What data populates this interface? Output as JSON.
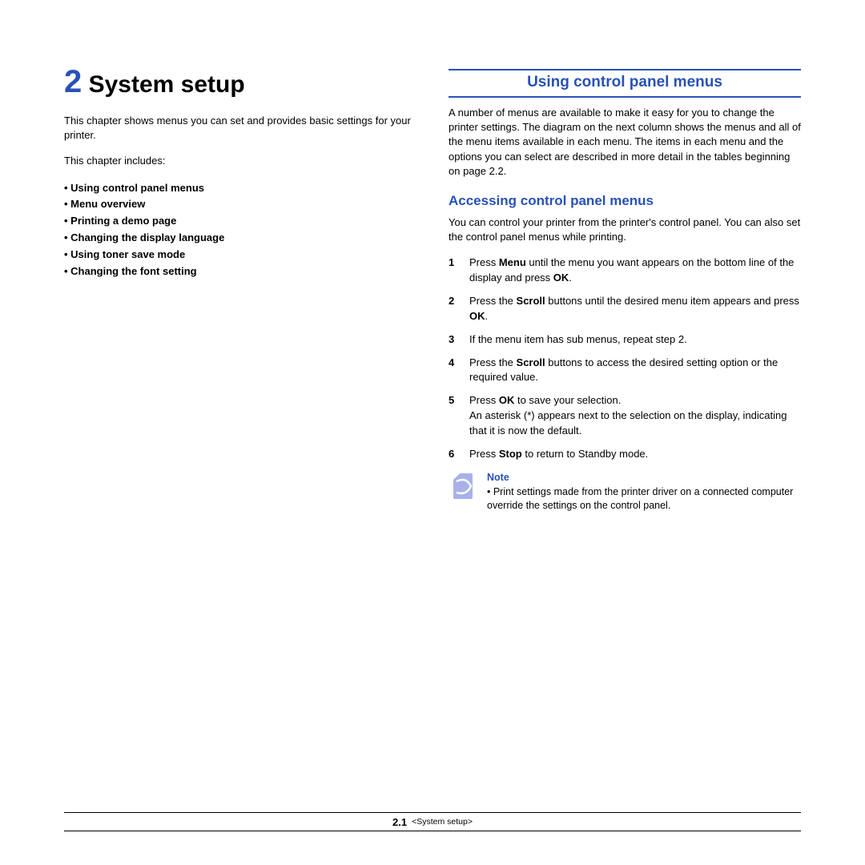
{
  "left": {
    "chapter_number": "2",
    "chapter_title": "System setup",
    "intro": "This chapter shows menus you can set and provides basic settings for your printer.",
    "includes_label": "This chapter includes:",
    "toc": [
      "Using control panel menus",
      "Menu overview",
      "Printing a demo page",
      "Changing the display language",
      "Using toner save mode",
      "Changing the font setting"
    ]
  },
  "right": {
    "section_title": "Using control panel menus",
    "section_body": "A number of menus are available to make it easy for you to change the printer settings. The diagram on the next column shows the menus and all of the menu items available in each menu. The items in each menu and the options you can select are described in more detail in the tables beginning on page 2.2.",
    "sub_title": "Accessing control panel menus",
    "sub_body": "You can control your printer from the printer's control panel. You can also set the control panel menus while printing.",
    "steps": [
      {
        "n": "1",
        "html": "Press <b>Menu</b> until the menu you want appears on the bottom line of the display and press <b>OK</b>."
      },
      {
        "n": "2",
        "html": "Press the <b>Scroll</b> buttons until the desired menu item appears and press <b>OK</b>."
      },
      {
        "n": "3",
        "html": "If the menu item has sub menus, repeat step 2."
      },
      {
        "n": "4",
        "html": "Press the <b>Scroll</b> buttons to access the desired setting option or the required value."
      },
      {
        "n": "5",
        "html": "Press <b>OK</b> to save your selection.<br>An asterisk (*) appears next to the selection on the display, indicating that it is now the default."
      },
      {
        "n": "6",
        "html": "Press <b>Stop</b> to return to Standby mode."
      }
    ],
    "note_title": "Note",
    "note_text": "• Print settings made from the printer driver on a connected computer override the settings on the control panel."
  },
  "footer": {
    "page": "2.1",
    "chapter": "<System setup>"
  }
}
